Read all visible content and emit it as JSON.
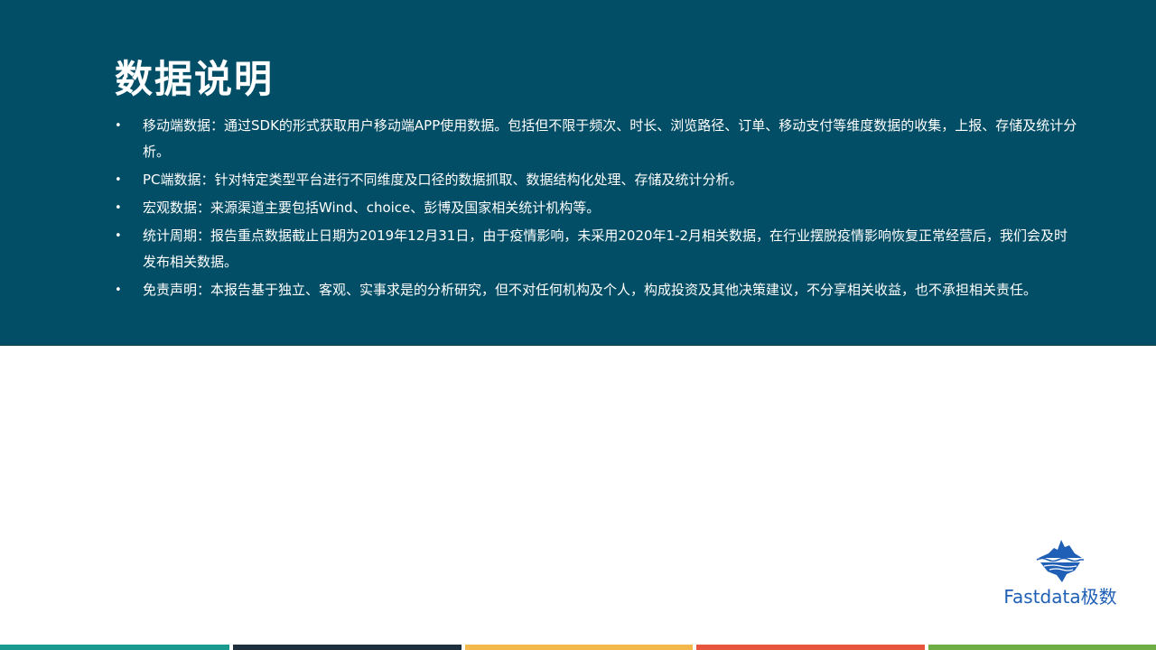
{
  "page": {
    "title": "数据说明",
    "bullet_symbol": "•",
    "items": [
      "移动端数据：通过SDK的形式获取用户移动端APP使用数据。包括但不限于频次、时长、浏览路径、订单、移动支付等维度数据的收集，上报、存储及统计分析。",
      "PC端数据：针对特定类型平台进行不同维度及口径的数据抓取、数据结构化处理、存储及统计分析。",
      "宏观数据：来源渠道主要包括Wind、choice、彭博及国家相关统计机构等。",
      "统计周期：报告重点数据截止日期为2019年12月31日，由于疫情影响，未采用2020年1-2月相关数据，在行业摆脱疫情影响恢复正常经营后，我们会及时发布相关数据。",
      "免责声明：本报告基于独立、客观、实事求是的分析研究，但不对任何机构及个人，构成投资及其他决策建议，不分享相关收益，也不承担相关责任。"
    ]
  },
  "logo": {
    "text": "Fastdata极数",
    "icon": "iceberg-icon",
    "color": "#1f5fb5"
  },
  "colors": {
    "banner_bg": "#024e66",
    "text": "#ffffff",
    "footer": [
      "#1a9a8e",
      "#1e2f3d",
      "#f2b84b",
      "#e8553f",
      "#6fae45"
    ]
  }
}
